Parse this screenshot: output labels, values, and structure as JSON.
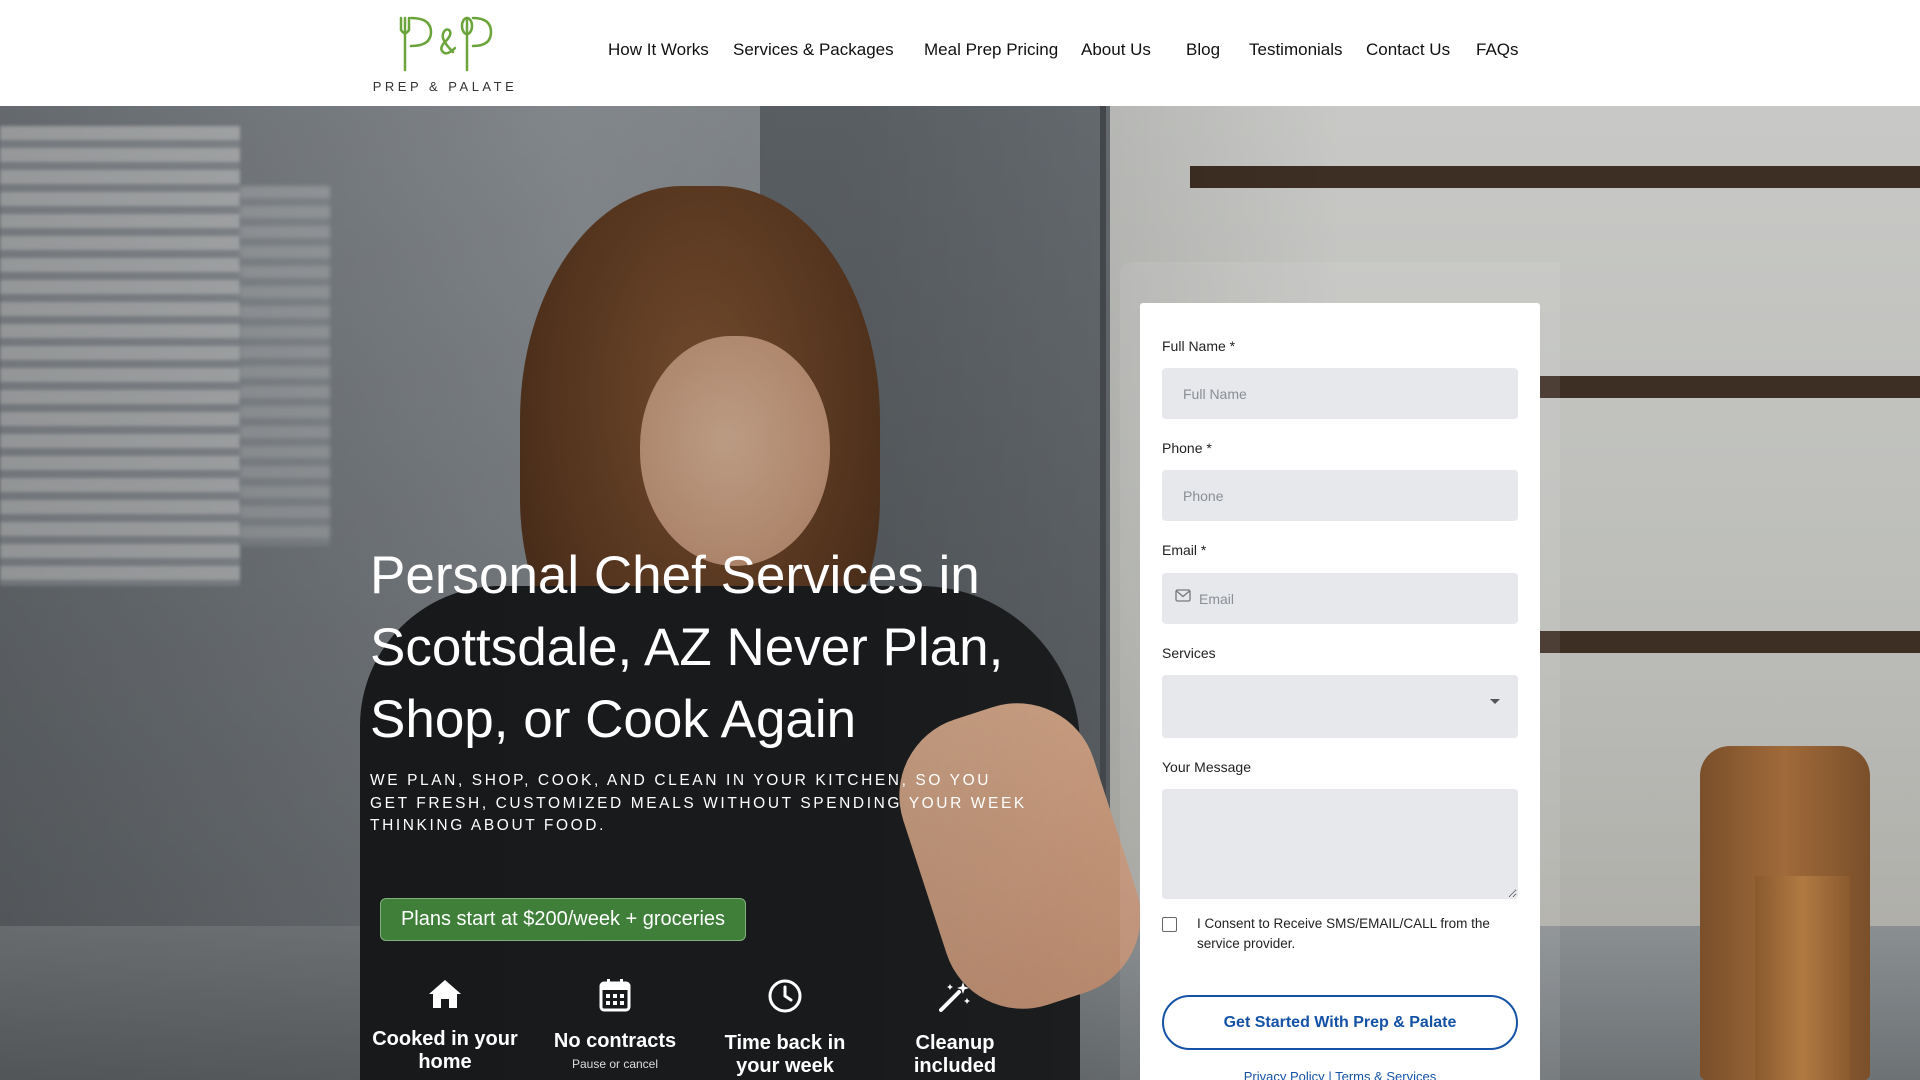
{
  "brand": {
    "logo_monogram": "P&P",
    "logo_text": "PREP & PALATE",
    "accent_green": "#6aa43a",
    "button_blue": "#1452a6"
  },
  "nav": {
    "items": [
      {
        "label": "How It Works"
      },
      {
        "label": "Services & Packages"
      },
      {
        "label": "Meal Prep Pricing"
      },
      {
        "label": "About Us"
      },
      {
        "label": "Blog"
      },
      {
        "label": "Testimonials"
      },
      {
        "label": "Contact Us"
      },
      {
        "label": "FAQs"
      }
    ]
  },
  "hero": {
    "title": "Personal Chef Services in Scottsdale, AZ Never Plan, Shop, or Cook Again",
    "subtitle": "We plan, shop, cook, and clean in your kitchen, so you get fresh, customized meals without spending your week thinking about food.",
    "price_pill": "Plans start at $200/week + groceries",
    "features": [
      {
        "icon": "home-icon",
        "title": "Cooked in your home",
        "sub": ""
      },
      {
        "icon": "calendar-icon",
        "title": "No contracts",
        "sub": "Pause or cancel"
      },
      {
        "icon": "clock-icon",
        "title": "Time back in your week",
        "sub": ""
      },
      {
        "icon": "magic-wand-icon",
        "title": "Cleanup included",
        "sub": ""
      }
    ]
  },
  "form": {
    "full_name_label": "Full Name *",
    "full_name_placeholder": "Full Name",
    "phone_label": "Phone *",
    "phone_placeholder": "Phone",
    "email_label": "Email *",
    "email_placeholder": "Email",
    "services_label": "Services",
    "message_label": "Your Message",
    "consent_text": "I Consent to Receive SMS/EMAIL/CALL from the service provider.",
    "submit_label": "Get Started With Prep & Palate",
    "privacy_link": "Privacy Policy",
    "separator": "|",
    "terms_link": "Terms & Services"
  }
}
